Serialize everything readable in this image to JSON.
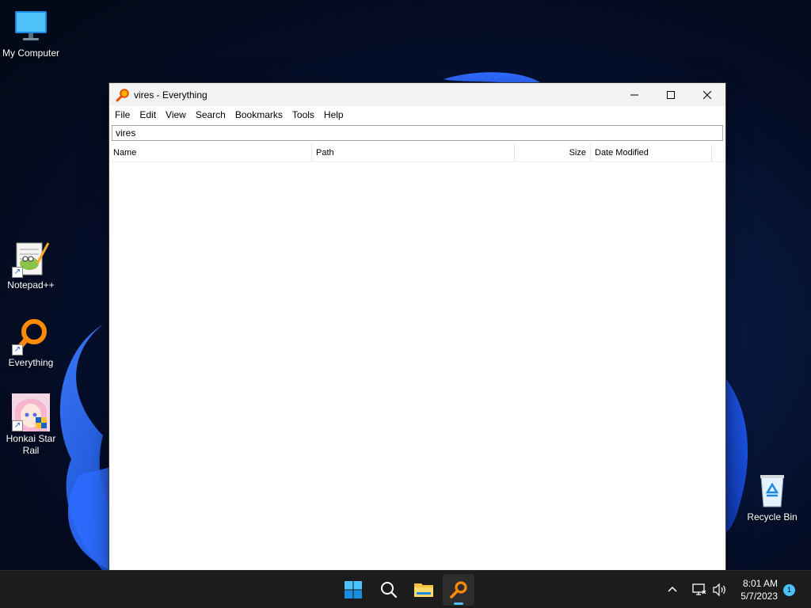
{
  "desktop": {
    "icons": [
      {
        "label": "My Computer",
        "icon": "monitor-icon"
      },
      {
        "label": "Notepad++",
        "icon": "notepadpp-icon"
      },
      {
        "label": "Everything",
        "icon": "everything-icon"
      },
      {
        "label": "Honkai Star Rail",
        "icon": "honkai-icon"
      },
      {
        "label": "Recycle Bin",
        "icon": "recycle-bin-icon"
      }
    ]
  },
  "window": {
    "title": "vires - Everything",
    "menu": [
      "File",
      "Edit",
      "View",
      "Search",
      "Bookmarks",
      "Tools",
      "Help"
    ],
    "search_value": "vires",
    "columns": [
      "Name",
      "Path",
      "Size",
      "Date Modified"
    ],
    "rows": []
  },
  "taskbar": {
    "apps": [
      "start-icon",
      "search-icon",
      "file-explorer-icon",
      "everything-icon"
    ],
    "active_app": "everything-icon",
    "time": "8:01 AM",
    "date": "5/7/2023",
    "notification_count": "1",
    "accent": "#4cc2ff"
  }
}
